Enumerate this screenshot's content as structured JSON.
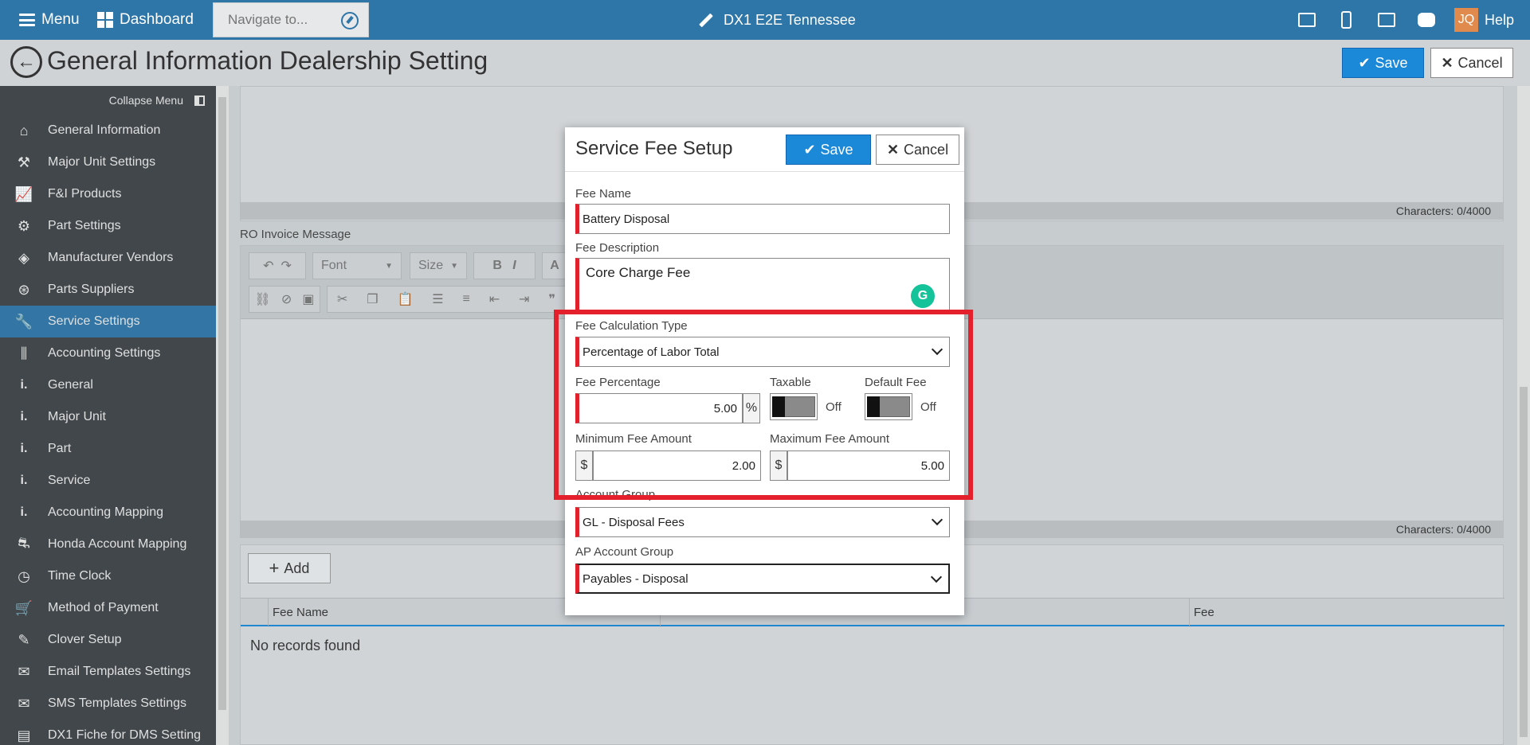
{
  "topbar": {
    "menu_label": "Menu",
    "dashboard_label": "Dashboard",
    "navigate_placeholder": "Navigate to...",
    "store_name": "DX1 E2E Tennessee",
    "avatar_initials": "JQ",
    "help_label": "Help"
  },
  "titlebar": {
    "title": "General Information Dealership Setting",
    "save_label": "Save",
    "cancel_label": "Cancel"
  },
  "sidebar": {
    "collapse_label": "Collapse Menu",
    "items": [
      {
        "label": "General Information",
        "icon": "home-icon",
        "glyph": "⌂"
      },
      {
        "label": "Major Unit Settings",
        "icon": "hammer-icon",
        "glyph": "⚒"
      },
      {
        "label": "F&I Products",
        "icon": "chart-icon",
        "glyph": "📈"
      },
      {
        "label": "Part Settings",
        "icon": "gear-icon",
        "glyph": "⚙"
      },
      {
        "label": "Manufacturer Vendors",
        "icon": "target-icon",
        "glyph": "◈"
      },
      {
        "label": "Parts Suppliers",
        "icon": "lifebuoy-icon",
        "glyph": "⊛"
      },
      {
        "label": "Service Settings",
        "icon": "wrench-icon",
        "glyph": "🔧"
      },
      {
        "label": "Accounting Settings",
        "icon": "sliders-icon",
        "glyph": "⫼"
      },
      {
        "label": "General",
        "icon": "sub-item-icon",
        "glyph": "i."
      },
      {
        "label": "Major Unit",
        "icon": "sub-item-icon",
        "glyph": "i."
      },
      {
        "label": "Part",
        "icon": "sub-item-icon",
        "glyph": "i."
      },
      {
        "label": "Service",
        "icon": "sub-item-icon",
        "glyph": "i."
      },
      {
        "label": "Accounting Mapping",
        "icon": "sub-item-icon",
        "glyph": "i."
      },
      {
        "label": "Honda Account Mapping",
        "icon": "motorcycle-icon",
        "glyph": "⛐"
      },
      {
        "label": "Time Clock",
        "icon": "clock-icon",
        "glyph": "◷"
      },
      {
        "label": "Method of Payment",
        "icon": "cart-icon",
        "glyph": "🛒"
      },
      {
        "label": "Clover Setup",
        "icon": "clover-icon",
        "glyph": "✎"
      },
      {
        "label": "Email Templates Settings",
        "icon": "envelope-open-icon",
        "glyph": "✉"
      },
      {
        "label": "SMS Templates Settings",
        "icon": "envelope-icon",
        "glyph": "✉"
      },
      {
        "label": "DX1 Fiche for DMS Setting",
        "icon": "newspaper-icon",
        "glyph": "▤"
      }
    ],
    "active_index": 6
  },
  "main": {
    "char_count_top": "Characters: 0/4000",
    "ro_invoice_label": "RO Invoice Message",
    "editor_font": "Font",
    "editor_size": "Size",
    "char_count_bottom": "Characters: 0/4000",
    "add_label": "Add",
    "grid_columns": [
      "Fee Name",
      "Fee"
    ],
    "no_records": "No records found"
  },
  "modal": {
    "title": "Service Fee Setup",
    "save_label": "Save",
    "cancel_label": "Cancel",
    "fee_name_label": "Fee Name",
    "fee_name_value": "Battery Disposal",
    "fee_description_label": "Fee Description",
    "fee_description_value": "Core Charge Fee",
    "fee_calc_type_label": "Fee Calculation Type",
    "fee_calc_type_value": "Percentage of Labor Total",
    "fee_percentage_label": "Fee Percentage",
    "fee_percentage_value": "5.00",
    "percent_symbol": "%",
    "taxable_label": "Taxable",
    "taxable_state": "Off",
    "default_fee_label": "Default Fee",
    "default_fee_state": "Off",
    "min_fee_label": "Minimum Fee Amount",
    "min_fee_value": "2.00",
    "max_fee_label": "Maximum Fee Amount",
    "max_fee_value": "5.00",
    "currency_symbol": "$",
    "account_group_label": "Account Group",
    "account_group_value": "GL - Disposal Fees",
    "ap_account_group_label": "AP Account Group",
    "ap_account_group_value": "Payables - Disposal"
  },
  "colors": {
    "topbar": "#2e75a8",
    "primary_button": "#1b88d8",
    "required_marker": "#e0202a",
    "highlight_box": "#e3202b",
    "sidebar": "#3e4347"
  }
}
